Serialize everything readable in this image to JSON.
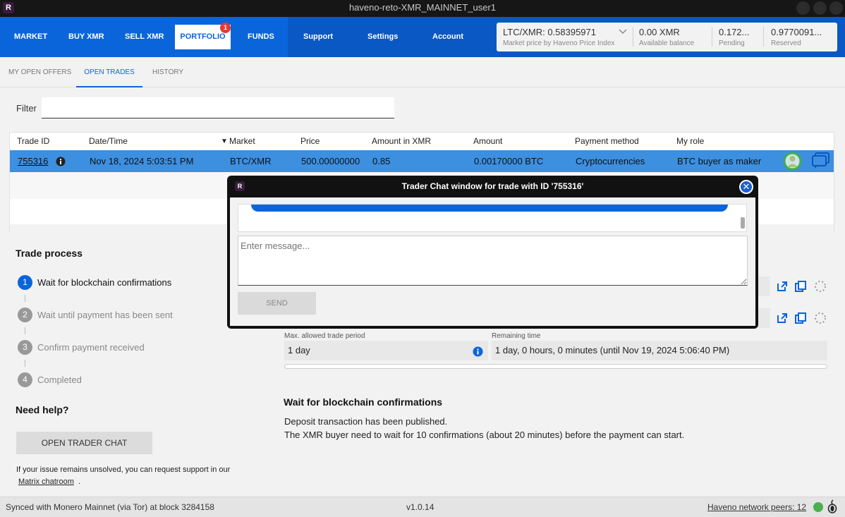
{
  "window": {
    "title": "haveno-reto-XMR_MAINNET_user1",
    "app_icon": "R"
  },
  "nav": {
    "market": "MARKET",
    "buy": "BUY XMR",
    "sell": "SELL XMR",
    "portfolio": "PORTFOLIO",
    "portfolio_badge": "1",
    "funds": "FUNDS",
    "support": "Support",
    "settings": "Settings",
    "account": "Account"
  },
  "balances": {
    "price_value": "LTC/XMR: 0.58395971",
    "price_label": "Market price by Haveno Price Index",
    "available_value": "0.00 XMR",
    "available_label": "Available balance",
    "pending_value": "0.172...",
    "pending_label": "Pending",
    "reserved_value": "0.9770091...",
    "reserved_label": "Reserved"
  },
  "subtabs": {
    "open_offers": "MY OPEN OFFERS",
    "open_trades": "OPEN TRADES",
    "history": "HISTORY"
  },
  "filter": {
    "label": "Filter",
    "value": ""
  },
  "table": {
    "headers": {
      "trade_id": "Trade ID",
      "datetime": "Date/Time",
      "market": "Market",
      "price": "Price",
      "amount_xmr": "Amount in XMR",
      "amount": "Amount",
      "payment": "Payment method",
      "role": "My role"
    },
    "sort_indicator": "▼",
    "rows": [
      {
        "trade_id": "755316",
        "datetime": "Nov 18, 2024 5:03:51 PM",
        "market": "BTC/XMR",
        "price": "500.00000000",
        "amount_xmr": "0.85",
        "amount": "0.00170000 BTC",
        "payment": "Cryptocurrencies",
        "role": "BTC buyer as maker"
      }
    ]
  },
  "process": {
    "title": "Trade process",
    "steps": [
      {
        "num": "1",
        "label": "Wait for blockchain confirmations"
      },
      {
        "num": "2",
        "label": "Wait until payment has been sent"
      },
      {
        "num": "3",
        "label": "Confirm payment received"
      },
      {
        "num": "4",
        "label": "Completed"
      }
    ]
  },
  "help": {
    "title": "Need help?",
    "button": "OPEN TRADER CHAT",
    "text": "If your issue remains unsolved, you can request support in our",
    "link": "Matrix chatroom",
    "dot": "."
  },
  "details": {
    "max_period_label": "Max. allowed trade period",
    "max_period_value": "1 day",
    "remaining_label": "Remaining time",
    "remaining_value": "1 day, 0 hours, 0 minutes (until Nov 19, 2024 5:06:40 PM)",
    "progress": 0.0
  },
  "wait": {
    "title": "Wait for blockchain confirmations",
    "line1": "Deposit transaction has been published.",
    "line2": "The XMR buyer need to wait for 10 confirmations (about 20 minutes) before the payment can start."
  },
  "status": {
    "sync": "Synced with Monero Mainnet (via Tor) at block 3284158",
    "version": "v1.0.14",
    "peers": "Haveno network peers: 12"
  },
  "chat": {
    "title": "Trader Chat window for trade with ID '755316'",
    "placeholder": "Enter message...",
    "send": "SEND",
    "close": "✕"
  },
  "colors": {
    "brand": "#0b65da",
    "selected_row": "#3d8fe0",
    "peer_online": "#4caf50"
  }
}
